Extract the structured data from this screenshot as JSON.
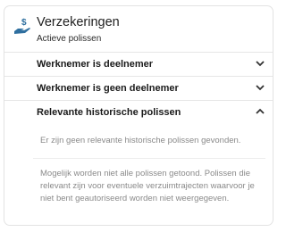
{
  "header": {
    "title": "Verzekeringen",
    "subtitle": "Actieve polissen",
    "icon": "insurance-hand-dollar-icon"
  },
  "sections": [
    {
      "label": "Werknemer is deelnemer",
      "expanded": false
    },
    {
      "label": "Werknemer is geen deelnemer",
      "expanded": false
    },
    {
      "label": "Relevante historische polissen",
      "expanded": true
    }
  ],
  "panel": {
    "empty_message": "Er zijn geen relevante historische polissen gevonden.",
    "note": "Mogelijk worden niet alle polissen getoond. Polissen die relevant zijn voor eventuele verzuimtrajecten waarvoor je niet bent geautoriseerd worden niet weergegeven."
  },
  "colors": {
    "accent_icon": "#2f6f9f",
    "border": "#e3e3e3",
    "muted_text": "#8a8a8a"
  }
}
